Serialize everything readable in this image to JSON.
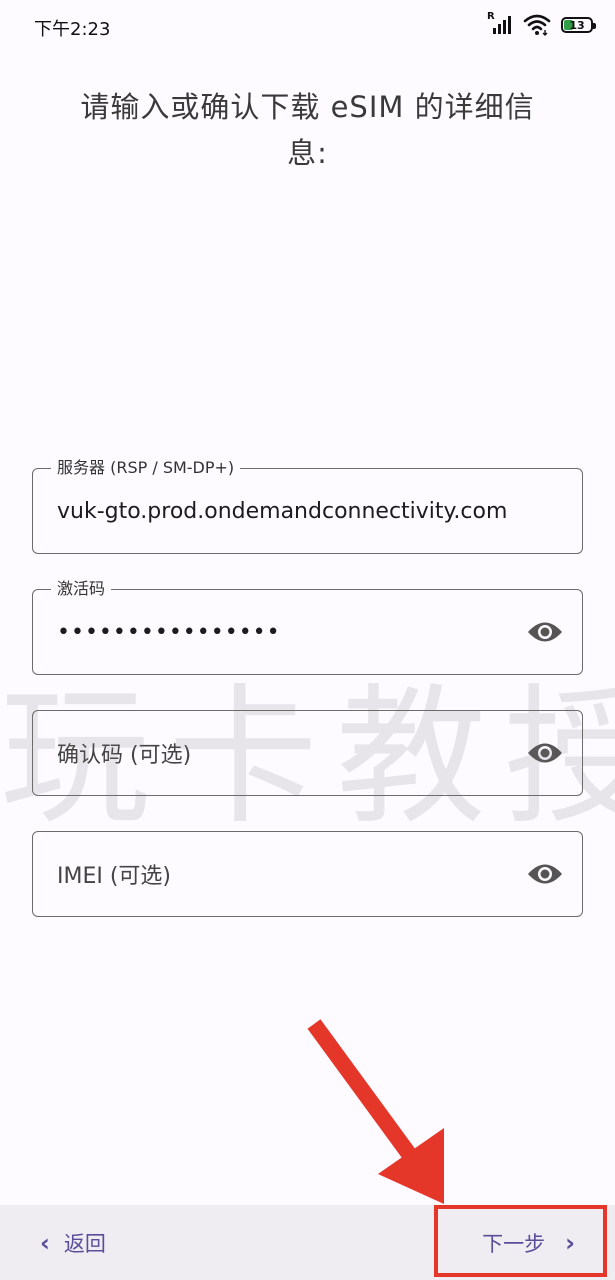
{
  "status_bar": {
    "time": "下午2:23",
    "signal_label": "R",
    "battery_level": "13"
  },
  "title": "请输入或确认下载 eSIM 的详细信息:",
  "fields": [
    {
      "label": "服务器 (RSP / SM-DP+)",
      "value": "vuk-gto.prod.ondemandconnectivity.com",
      "placeholder": "",
      "has_visibility_toggle": false
    },
    {
      "label": "激活码",
      "value": "••••••••••••••••",
      "placeholder": "",
      "has_visibility_toggle": true
    },
    {
      "label": "",
      "value": "",
      "placeholder": "确认码 (可选)",
      "has_visibility_toggle": true
    },
    {
      "label": "",
      "value": "",
      "placeholder": "IMEI (可选)",
      "has_visibility_toggle": true
    }
  ],
  "watermark": "玩卡教授",
  "bottom_bar": {
    "back_label": "返回",
    "next_label": "下一步"
  },
  "colors": {
    "accent": "#5a4e9b",
    "annotation": "#e5362a",
    "background": "#fdfbff",
    "bottom_bar": "#efedf1"
  }
}
